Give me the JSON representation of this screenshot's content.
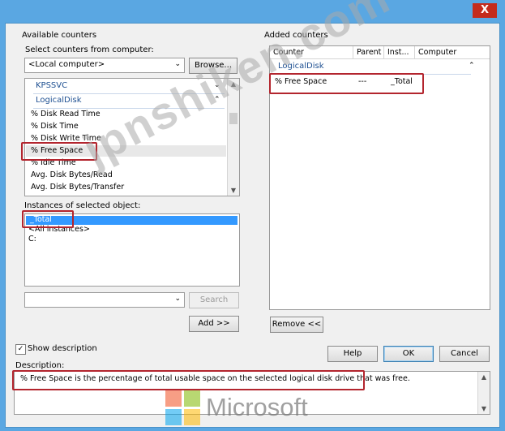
{
  "window": {
    "close_glyph": "X"
  },
  "available": {
    "title": "Available counters",
    "computer_label": "Select counters from computer:",
    "computer_value": "<Local computer>",
    "browse_label": "Browse...",
    "objects": [
      {
        "label": "KPSSVC",
        "expanded": false
      },
      {
        "label": "LogicalDisk",
        "expanded": true
      }
    ],
    "counters": [
      "% Disk Read Time",
      "% Disk Time",
      "% Disk Write Time",
      "% Free Space",
      "% Idle Time",
      "Avg. Disk Bytes/Read",
      "Avg. Disk Bytes/Transfer"
    ],
    "selected_counter": "% Free Space",
    "instances_label": "Instances of selected object:",
    "instances": [
      "_Total",
      "<All instances>",
      "C:"
    ],
    "selected_instance": "_Total",
    "search_label": "Search",
    "add_label": "Add >>"
  },
  "added": {
    "title": "Added counters",
    "columns": [
      "Counter",
      "Parent",
      "Inst...",
      "Computer"
    ],
    "group": "LogicalDisk",
    "rows": [
      {
        "counter": "% Free Space",
        "parent": "---",
        "instance": "_Total",
        "computer": ""
      }
    ],
    "remove_label": "Remove <<"
  },
  "show_description": {
    "label": "Show description",
    "checked": true
  },
  "buttons": {
    "help": "Help",
    "ok": "OK",
    "cancel": "Cancel"
  },
  "description": {
    "label": "Description:",
    "text": "% Free Space is the percentage of total usable space on the selected logical disk drive that was free."
  },
  "overlay": {
    "watermark": "jpnshiken.com",
    "logo_text": "Microsoft"
  },
  "colors": {
    "title_bar": "#5aa7e2",
    "close": "#c42b1c",
    "highlight_box": "#b3252e",
    "selection": "#3399ff",
    "group_text": "#1d4f91"
  }
}
